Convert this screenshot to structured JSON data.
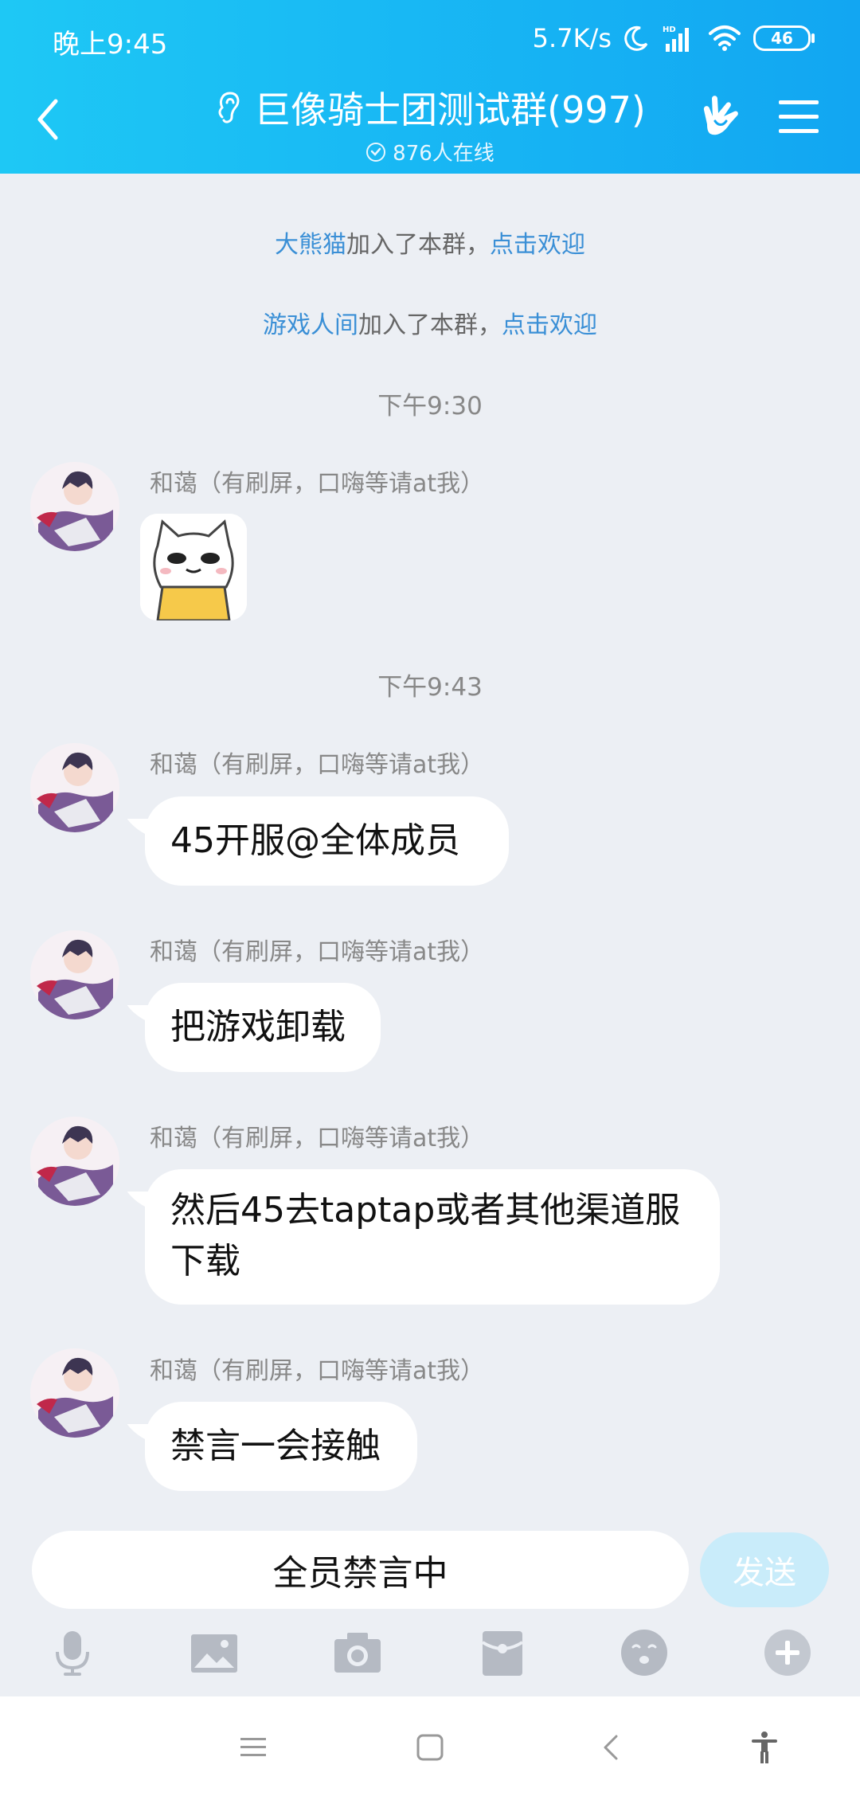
{
  "status_bar": {
    "time": "晚上9:45",
    "net_speed": "5.7K/s",
    "battery": "46"
  },
  "header": {
    "title": "巨像骑士团测试群(997)",
    "online": "876人在线"
  },
  "system_messages": [
    {
      "name": "大熊猫",
      "text": "加入了本群，",
      "action": "点击欢迎"
    },
    {
      "name": "游戏人间",
      "text": "加入了本群，",
      "action": "点击欢迎"
    }
  ],
  "time_separators": [
    "下午9:30",
    "下午9:43"
  ],
  "sender_name": "和蔼（有刷屏，口嗨等请at我）",
  "messages": [
    {
      "text": "45开服@全体成员"
    },
    {
      "text": "把游戏卸载"
    },
    {
      "text": "然后45去taptap或者其他渠道服下载"
    },
    {
      "text": "禁言一会接触"
    }
  ],
  "input": {
    "placeholder": "全员禁言中",
    "send_label": "发送"
  },
  "toolbar_icons": [
    "mic-icon",
    "image-icon",
    "camera-icon",
    "red-packet-icon",
    "emoji-icon",
    "plus-icon"
  ],
  "colors": {
    "header_start": "#1ec8f5",
    "header_end": "#12a6f2",
    "link": "#3a8fd6",
    "background": "#eceff4",
    "send_disabled": "#c9ecfa"
  }
}
